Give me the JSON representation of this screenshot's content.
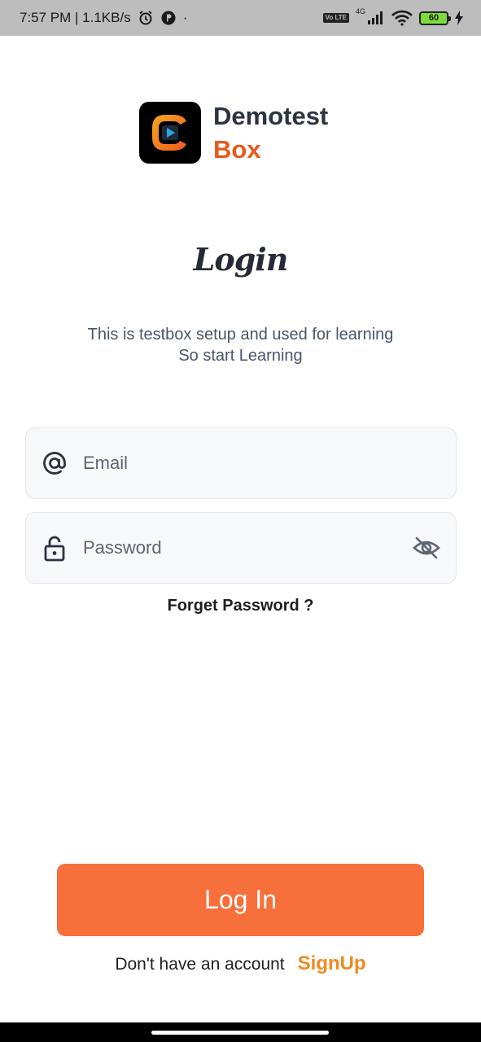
{
  "status_bar": {
    "time_speed": "7:57 PM | 1.1KB/s",
    "dot": "·",
    "volte": "Vo LTE",
    "network": "4G",
    "battery": "60"
  },
  "brand": {
    "line1": "Demotest",
    "line2": "Box",
    "colors": {
      "dark": "#2d3340",
      "accent": "#e8591f"
    }
  },
  "login": {
    "title": "Login",
    "subtitle_line1": "This is testbox setup and used for learning",
    "subtitle_line2": "So start Learning"
  },
  "form": {
    "email_placeholder": "Email",
    "email_value": "",
    "password_placeholder": "Password",
    "password_value": "",
    "forget_label": "Forget Password ?"
  },
  "actions": {
    "login_label": "Log In",
    "login_color": "#f7703b",
    "signup_prompt": "Don't have an account",
    "signup_label": "SignUp"
  },
  "icons": {
    "email": "at-icon",
    "password": "lock-icon",
    "toggle": "eye-off-icon"
  }
}
